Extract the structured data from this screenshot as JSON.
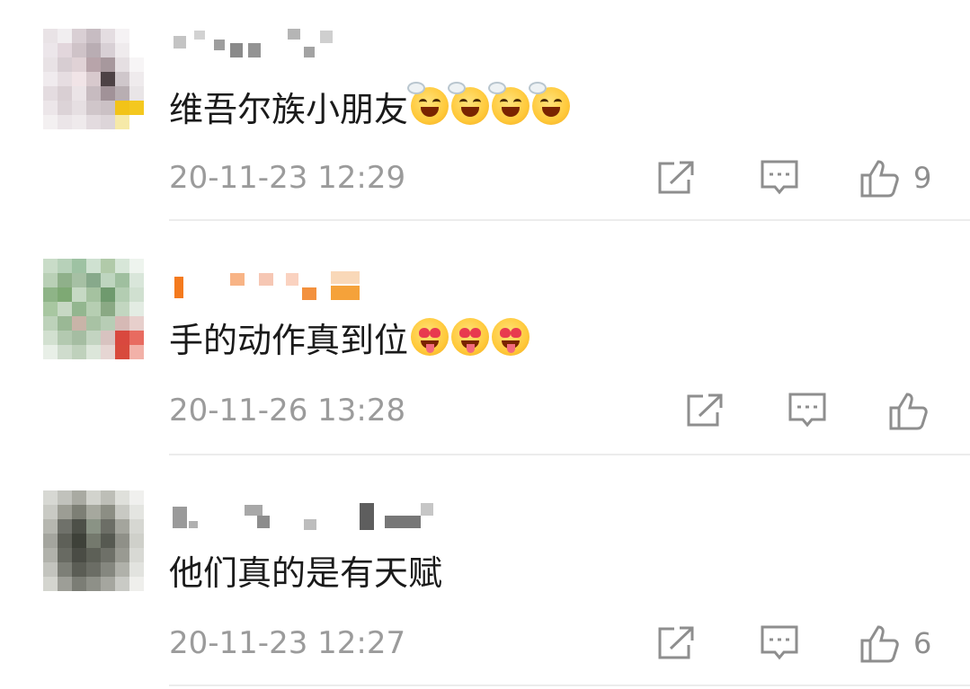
{
  "comments": [
    {
      "text": "维吾尔族小朋友",
      "emojis": [
        "grinning-squint-icon",
        "grinning-squint-icon",
        "grinning-squint-icon",
        "grinning-squint-icon"
      ],
      "timestamp": "20-11-23 12:29",
      "likes": "9"
    },
    {
      "text": "手的动作真到位",
      "emojis": [
        "heart-eyes-tongue-icon",
        "heart-eyes-tongue-icon",
        "heart-eyes-tongue-icon"
      ],
      "timestamp": "20-11-26 13:28",
      "likes": ""
    },
    {
      "text": "他们真的是有天赋",
      "emojis": [],
      "timestamp": "20-11-23 12:27",
      "likes": "6"
    }
  ],
  "icons": {
    "share": "share-icon",
    "reply": "comment-icon",
    "like": "thumbs-up-icon"
  },
  "colors": {
    "text": "#1a1a1a",
    "meta": "#9b9b9b",
    "icon": "#8e8e8e",
    "divider": "#ececec"
  }
}
